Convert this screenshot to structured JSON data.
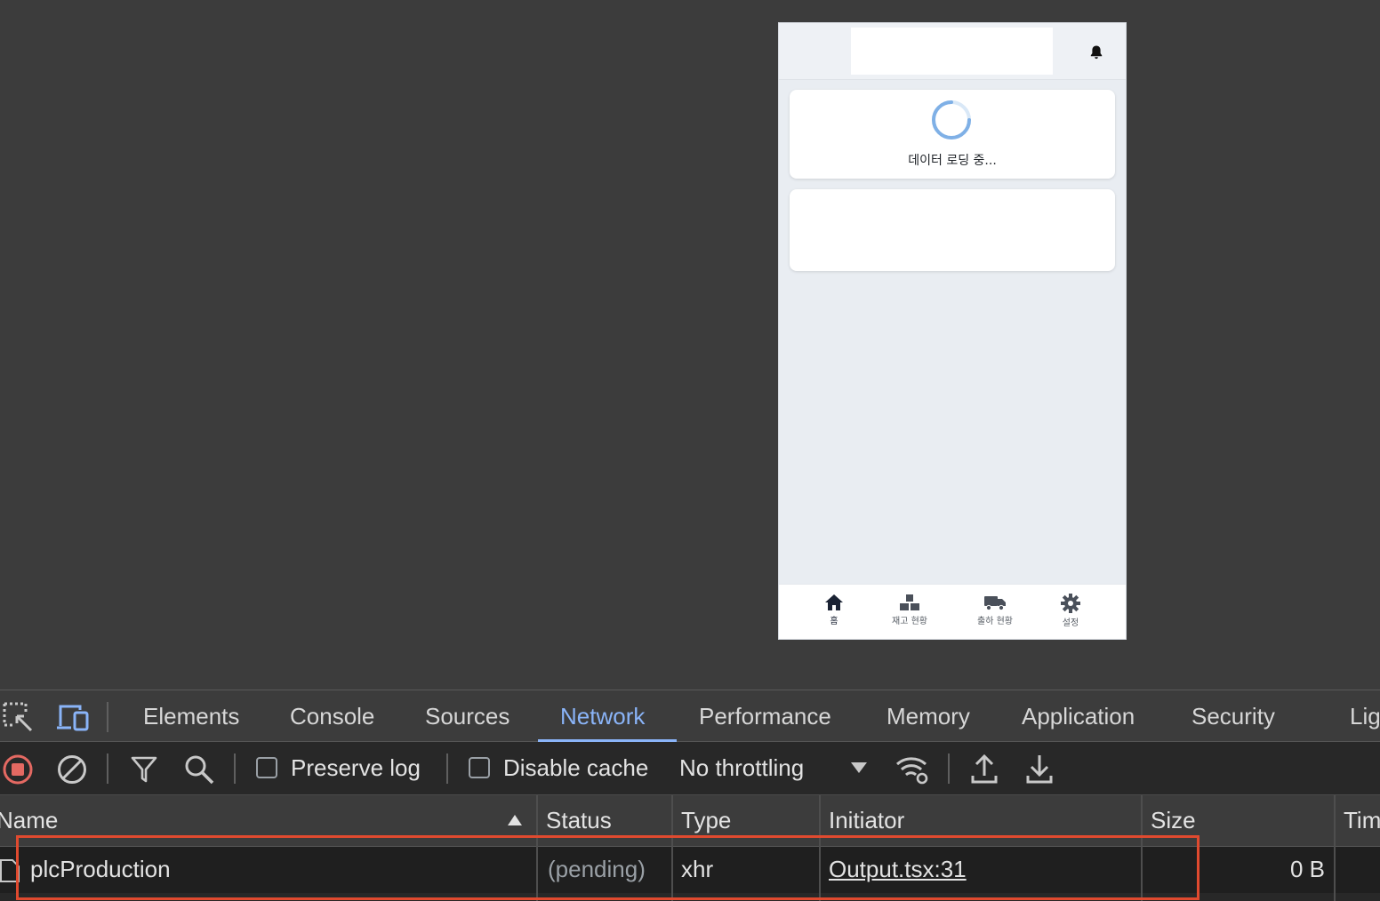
{
  "mobile_app": {
    "loading_text": "데이터 로딩 중...",
    "nav_items": [
      {
        "label": "홈",
        "icon": "home-icon",
        "active": true
      },
      {
        "label": "재고 현황",
        "icon": "boxes-icon",
        "active": false
      },
      {
        "label": "출하 현황",
        "icon": "truck-icon",
        "active": false
      },
      {
        "label": "설정",
        "icon": "gear-icon",
        "active": false
      }
    ],
    "colors": {
      "spinner": "#7fb0e6",
      "background": "#e9edf2"
    }
  },
  "devtools": {
    "tabs": [
      "Elements",
      "Console",
      "Sources",
      "Network",
      "Performance",
      "Memory",
      "Application",
      "Security",
      "Lig"
    ],
    "active_tab": "Network",
    "toolbar": {
      "preserve_log": "Preserve log",
      "disable_cache": "Disable cache",
      "throttling": "No throttling"
    },
    "columns": [
      "Name",
      "Status",
      "Type",
      "Initiator",
      "Size",
      "Tim"
    ],
    "sort_column": "Name",
    "rows": [
      {
        "name": "plcProduction",
        "status": "(pending)",
        "type": "xhr",
        "initiator": "Output.tsx:31",
        "size": "0 B"
      }
    ],
    "colors": {
      "accent": "#8ab4f8",
      "highlight_box": "#e04a2f",
      "record": "#e46962"
    }
  }
}
